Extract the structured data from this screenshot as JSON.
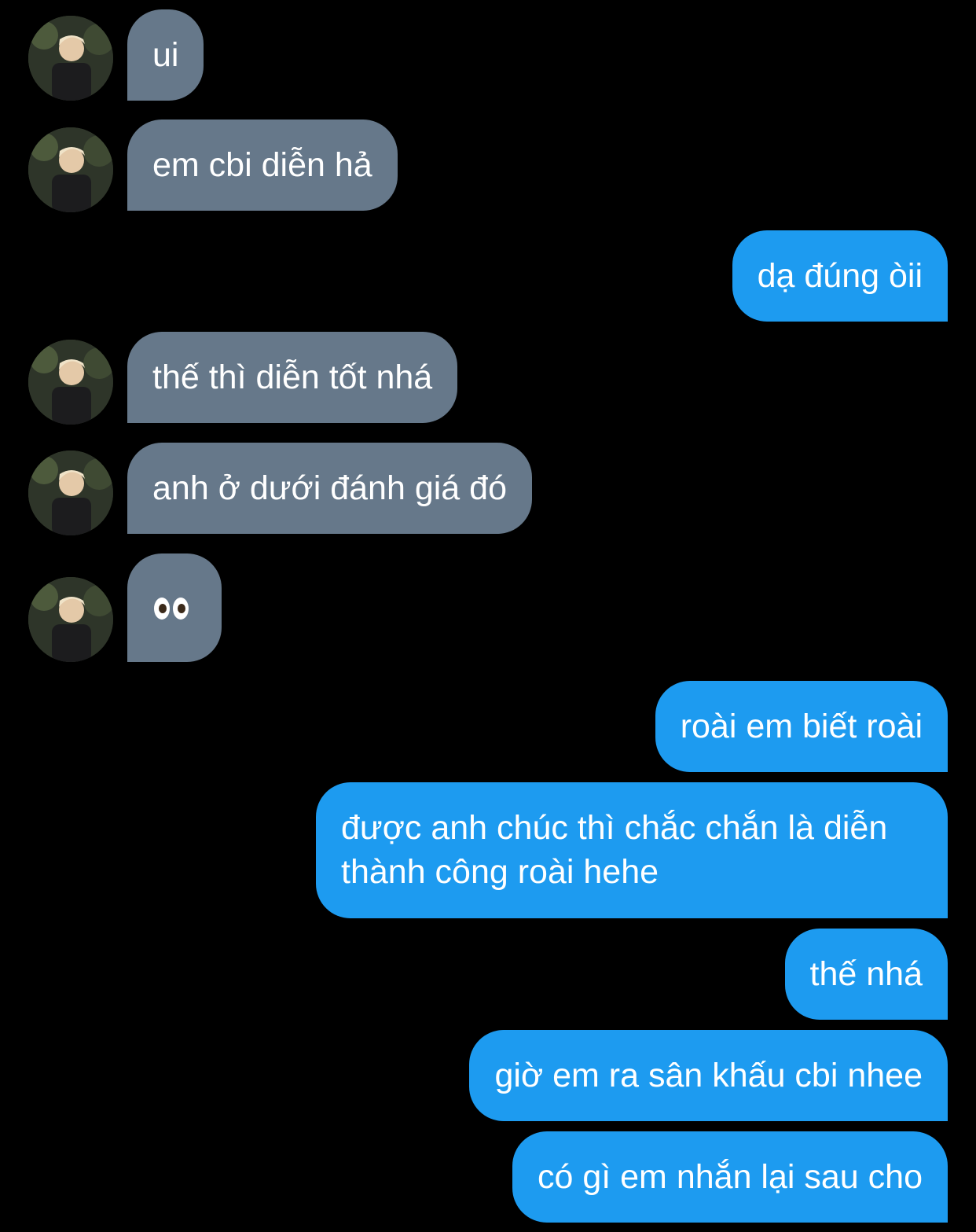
{
  "conversation": {
    "messages": [
      {
        "side": "in",
        "text": "ui",
        "has_avatar": true
      },
      {
        "side": "in",
        "text": "em cbi diễn hả",
        "has_avatar": true
      },
      {
        "side": "out",
        "text": "dạ đúng òii"
      },
      {
        "side": "in",
        "text": "thế thì diễn tốt nhá",
        "has_avatar": true
      },
      {
        "side": "in",
        "text": "anh ở dưới đánh giá đó",
        "has_avatar": true
      },
      {
        "side": "in",
        "emoji": "eyes",
        "has_avatar": true
      },
      {
        "side": "out",
        "text": "roài em biết roài"
      },
      {
        "side": "out",
        "text": "được anh chúc thì chắc chắn là diễn thành công roài hehe"
      },
      {
        "side": "out",
        "text": "thế nhá"
      },
      {
        "side": "out",
        "text": "giờ em ra sân khấu cbi nhee"
      },
      {
        "side": "out",
        "text": "có gì em nhắn lại sau cho"
      }
    ]
  },
  "colors": {
    "background": "#000000",
    "incoming_bubble": "#66788a",
    "outgoing_bubble": "#1d9bf0",
    "text": "#ffffff"
  }
}
